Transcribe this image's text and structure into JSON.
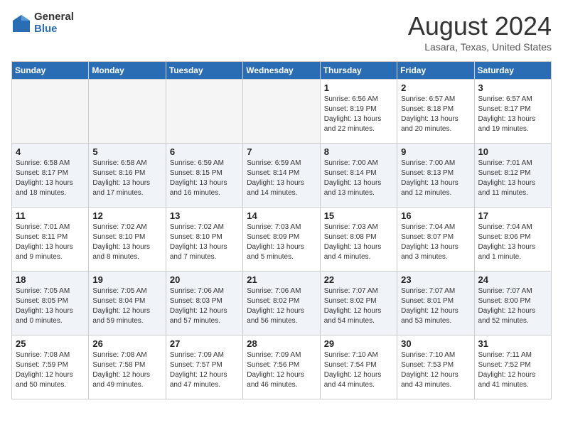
{
  "logo": {
    "general": "General",
    "blue": "Blue"
  },
  "title": "August 2024",
  "location": "Lasara, Texas, United States",
  "days": [
    "Sunday",
    "Monday",
    "Tuesday",
    "Wednesday",
    "Thursday",
    "Friday",
    "Saturday"
  ],
  "weeks": [
    [
      {
        "date": "",
        "info": ""
      },
      {
        "date": "",
        "info": ""
      },
      {
        "date": "",
        "info": ""
      },
      {
        "date": "",
        "info": ""
      },
      {
        "date": "1",
        "info": "Sunrise: 6:56 AM\nSunset: 8:19 PM\nDaylight: 13 hours\nand 22 minutes."
      },
      {
        "date": "2",
        "info": "Sunrise: 6:57 AM\nSunset: 8:18 PM\nDaylight: 13 hours\nand 20 minutes."
      },
      {
        "date": "3",
        "info": "Sunrise: 6:57 AM\nSunset: 8:17 PM\nDaylight: 13 hours\nand 19 minutes."
      }
    ],
    [
      {
        "date": "4",
        "info": "Sunrise: 6:58 AM\nSunset: 8:17 PM\nDaylight: 13 hours\nand 18 minutes."
      },
      {
        "date": "5",
        "info": "Sunrise: 6:58 AM\nSunset: 8:16 PM\nDaylight: 13 hours\nand 17 minutes."
      },
      {
        "date": "6",
        "info": "Sunrise: 6:59 AM\nSunset: 8:15 PM\nDaylight: 13 hours\nand 16 minutes."
      },
      {
        "date": "7",
        "info": "Sunrise: 6:59 AM\nSunset: 8:14 PM\nDaylight: 13 hours\nand 14 minutes."
      },
      {
        "date": "8",
        "info": "Sunrise: 7:00 AM\nSunset: 8:14 PM\nDaylight: 13 hours\nand 13 minutes."
      },
      {
        "date": "9",
        "info": "Sunrise: 7:00 AM\nSunset: 8:13 PM\nDaylight: 13 hours\nand 12 minutes."
      },
      {
        "date": "10",
        "info": "Sunrise: 7:01 AM\nSunset: 8:12 PM\nDaylight: 13 hours\nand 11 minutes."
      }
    ],
    [
      {
        "date": "11",
        "info": "Sunrise: 7:01 AM\nSunset: 8:11 PM\nDaylight: 13 hours\nand 9 minutes."
      },
      {
        "date": "12",
        "info": "Sunrise: 7:02 AM\nSunset: 8:10 PM\nDaylight: 13 hours\nand 8 minutes."
      },
      {
        "date": "13",
        "info": "Sunrise: 7:02 AM\nSunset: 8:10 PM\nDaylight: 13 hours\nand 7 minutes."
      },
      {
        "date": "14",
        "info": "Sunrise: 7:03 AM\nSunset: 8:09 PM\nDaylight: 13 hours\nand 5 minutes."
      },
      {
        "date": "15",
        "info": "Sunrise: 7:03 AM\nSunset: 8:08 PM\nDaylight: 13 hours\nand 4 minutes."
      },
      {
        "date": "16",
        "info": "Sunrise: 7:04 AM\nSunset: 8:07 PM\nDaylight: 13 hours\nand 3 minutes."
      },
      {
        "date": "17",
        "info": "Sunrise: 7:04 AM\nSunset: 8:06 PM\nDaylight: 13 hours\nand 1 minute."
      }
    ],
    [
      {
        "date": "18",
        "info": "Sunrise: 7:05 AM\nSunset: 8:05 PM\nDaylight: 13 hours\nand 0 minutes."
      },
      {
        "date": "19",
        "info": "Sunrise: 7:05 AM\nSunset: 8:04 PM\nDaylight: 12 hours\nand 59 minutes."
      },
      {
        "date": "20",
        "info": "Sunrise: 7:06 AM\nSunset: 8:03 PM\nDaylight: 12 hours\nand 57 minutes."
      },
      {
        "date": "21",
        "info": "Sunrise: 7:06 AM\nSunset: 8:02 PM\nDaylight: 12 hours\nand 56 minutes."
      },
      {
        "date": "22",
        "info": "Sunrise: 7:07 AM\nSunset: 8:02 PM\nDaylight: 12 hours\nand 54 minutes."
      },
      {
        "date": "23",
        "info": "Sunrise: 7:07 AM\nSunset: 8:01 PM\nDaylight: 12 hours\nand 53 minutes."
      },
      {
        "date": "24",
        "info": "Sunrise: 7:07 AM\nSunset: 8:00 PM\nDaylight: 12 hours\nand 52 minutes."
      }
    ],
    [
      {
        "date": "25",
        "info": "Sunrise: 7:08 AM\nSunset: 7:59 PM\nDaylight: 12 hours\nand 50 minutes."
      },
      {
        "date": "26",
        "info": "Sunrise: 7:08 AM\nSunset: 7:58 PM\nDaylight: 12 hours\nand 49 minutes."
      },
      {
        "date": "27",
        "info": "Sunrise: 7:09 AM\nSunset: 7:57 PM\nDaylight: 12 hours\nand 47 minutes."
      },
      {
        "date": "28",
        "info": "Sunrise: 7:09 AM\nSunset: 7:56 PM\nDaylight: 12 hours\nand 46 minutes."
      },
      {
        "date": "29",
        "info": "Sunrise: 7:10 AM\nSunset: 7:54 PM\nDaylight: 12 hours\nand 44 minutes."
      },
      {
        "date": "30",
        "info": "Sunrise: 7:10 AM\nSunset: 7:53 PM\nDaylight: 12 hours\nand 43 minutes."
      },
      {
        "date": "31",
        "info": "Sunrise: 7:11 AM\nSunset: 7:52 PM\nDaylight: 12 hours\nand 41 minutes."
      }
    ]
  ]
}
